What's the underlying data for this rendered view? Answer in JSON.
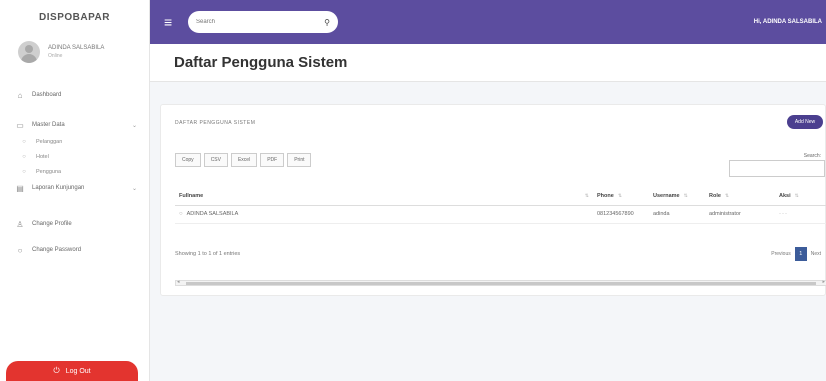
{
  "sidebar": {
    "brand": "DISPOBAPAR",
    "user_name": "ADINDA SALSABILA",
    "user_status": "Online",
    "section_main": "",
    "dashboard_label": "Dashboard",
    "section_data": "",
    "master_data_label": "Master Data",
    "sub_items": [
      {
        "label": "Pelanggan"
      },
      {
        "label": "Hotel"
      },
      {
        "label": "Pengguna"
      }
    ],
    "laporan_label": "Laporan Kunjungan",
    "section_settings": "",
    "change_profile_label": "Change Profile",
    "change_password_label": "Change Password",
    "logout_label": "Log Out"
  },
  "navbar": {
    "search_placeholder": "Search",
    "user_greeting": "Hi, ADINDA SALSABILA"
  },
  "page": {
    "title": "Daftar Pengguna Sistem"
  },
  "card": {
    "title": "DAFTAR PENGGUNA SISTEM",
    "add_button": "Add New",
    "tools": [
      "Copy",
      "CSV",
      "Excel",
      "PDF",
      "Print"
    ],
    "search_label": "Search:",
    "table": {
      "headers": [
        "Fullname",
        "Phone",
        "Username",
        "Role",
        "Aksi"
      ],
      "rows": [
        {
          "fullname": "ADINDA SALSABILA",
          "phone": "081234567890",
          "username": "adinda",
          "role": "administrator",
          "aksi": "···"
        }
      ]
    },
    "info": "Showing 1 to 1 of 1 entries",
    "previous_label": "Previous",
    "page_number": "1",
    "next_label": "Next"
  },
  "icons": {
    "menu": "hamburger-icon",
    "search": "search-icon",
    "logout": "power-icon"
  },
  "colors": {
    "navbar": "#5c4d9f",
    "logout": "#e3342f",
    "primary_button": "#4b3f8f",
    "active_page": "#3c5c9a"
  }
}
